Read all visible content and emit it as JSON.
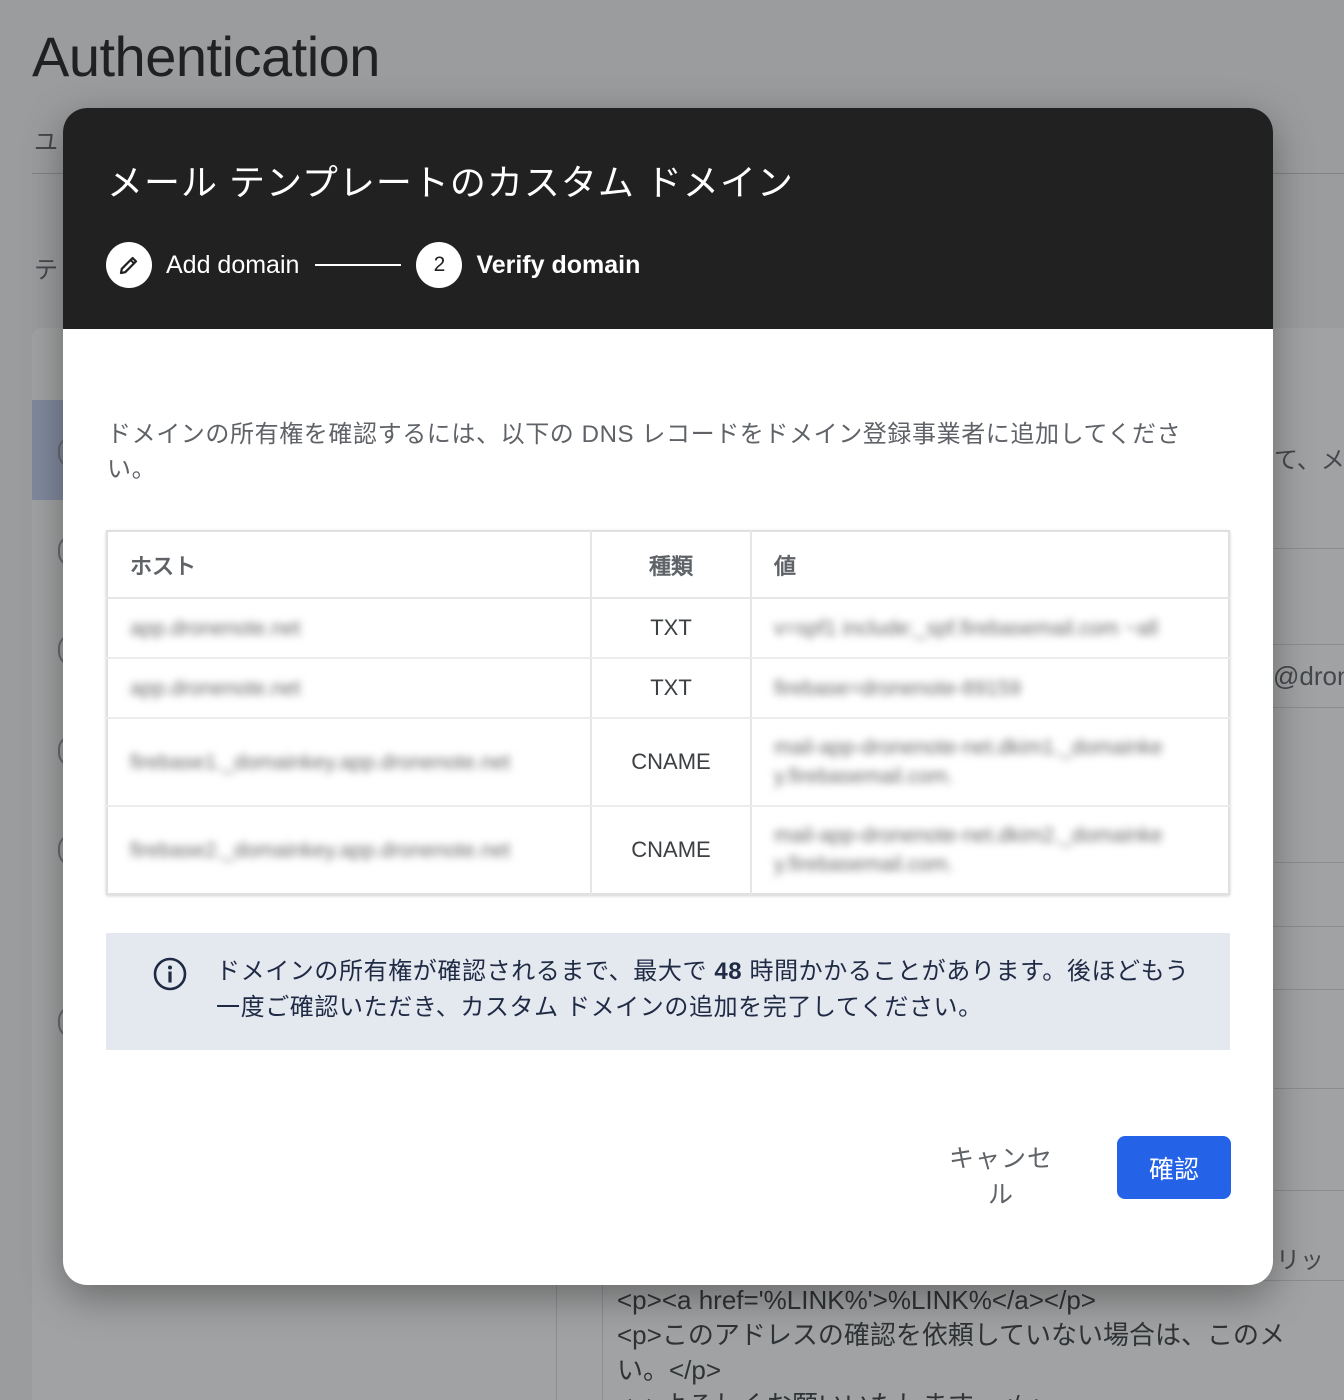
{
  "background": {
    "page_title": "Authentication",
    "tab_fragment": "ユ",
    "subtitle_fragment": "テ",
    "right_fragment_1": "て、メー",
    "right_fragment_2": "@dron",
    "right_fragment_3": "リッ",
    "code_lines": [
      "<p><a href='%LINK%'>%LINK%</a></p>",
      "<p>このアドレスの確認を依頼していない場合は、このメ",
      "い。</p>",
      "<p>よろしくお願いいたします。</p>"
    ]
  },
  "dialog": {
    "title": "メール テンプレートのカスタム ドメイン",
    "steps": [
      {
        "number": "",
        "icon": "pencil-icon",
        "label": "Add domain",
        "state": "completed"
      },
      {
        "number": "2",
        "label": "Verify domain",
        "state": "active"
      }
    ],
    "description": "ドメインの所有権を確認するには、以下の DNS レコードをドメイン登録事業者に追加してください。",
    "table": {
      "headers": {
        "host": "ホスト",
        "type": "種類",
        "value": "値"
      },
      "rows": [
        {
          "host": "app.dronenote.net",
          "type": "TXT",
          "value": "v=spf1 include:_spf.firebasemail.com ~all"
        },
        {
          "host": "app.dronenote.net",
          "type": "TXT",
          "value": "firebase=dronenote-89159"
        },
        {
          "host": "firebase1._domainkey.app.dronenote.net",
          "type": "CNAME",
          "value": "mail-app-dronenote-net.dkim1._domainkey.firebasemail.com."
        },
        {
          "host": "firebase2._domainkey.app.dronenote.net",
          "type": "CNAME",
          "value": "mail-app-dronenote-net.dkim2._domainkey.firebasemail.com."
        }
      ]
    },
    "info": {
      "icon": "info-icon",
      "text_before": "ドメインの所有権が確認されるまで、最大で ",
      "hours": "48",
      "text_after": " 時間かかることがあります。後ほどもう一度ご確認いただき、カスタム ドメインの追加を完了してください。"
    },
    "buttons": {
      "cancel": "キャンセル",
      "confirm": "確認"
    }
  },
  "colors": {
    "header_bg": "#212121",
    "primary_button": "#2462e8",
    "info_bg": "#e4e8ef"
  }
}
